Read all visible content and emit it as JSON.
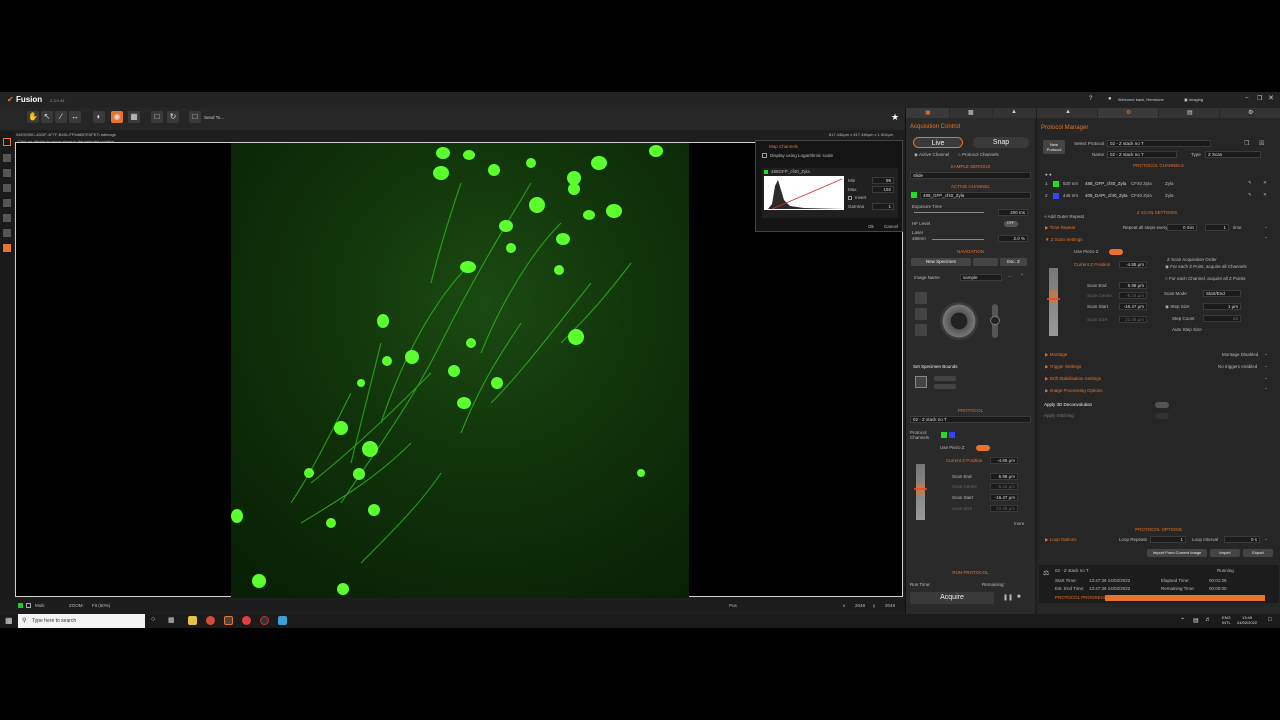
{
  "app": {
    "name": "Fusion",
    "version": "2.3.0.44",
    "welcome": "Welcome back, Hermione",
    "mode": "Imaging"
  },
  "toolbar": {
    "send_to": "Send To..."
  },
  "viewer": {
    "file_path": "04E9930C-4DDF-4F7F-B451-FF9A6B7E0FE7\\.ndimage",
    "hint": "Click on display to move stage to the selected position",
    "dims": "617.446μm x 617.446μm x 1.504μm"
  },
  "map_channels": {
    "title": "Map Channels",
    "log_label": "Display using Logarithmic scale",
    "channel": "488GFP_cf40_Zyla",
    "min_label": "Min",
    "min": "99",
    "max_label": "Max",
    "max": "192",
    "invert": "Invert",
    "gamma_label": "Gamma",
    "gamma": "1",
    "ok": "Ok",
    "cancel": "Cancel"
  },
  "statusbar": {
    "multi": "Multi",
    "zoom_label": "ZOOM:",
    "zoom": "Fit (60%)",
    "pos": "Pos",
    "x_label": "x",
    "x": "2048",
    "y_label": "y",
    "y": "2048"
  },
  "acq": {
    "title": "Acquisition Control",
    "live": "Live",
    "snap": "Snap",
    "active_channel": "Active Channel",
    "protocol_channels": "Protocol Channels",
    "sample_section": "SAMPLE SERIOUS",
    "slide": "Slide",
    "active_channels": "ACTIVE CHANNEL",
    "channel": "488_GFP_cf40_Zyla",
    "exposure_label": "Exposure Time",
    "exposure": "200 ms",
    "hf_label": "HF Level",
    "hf": "OFF",
    "laser_label": "Laser",
    "laser_sub": "488nm",
    "laser": "2.0 %",
    "navigation": "NAVIGATION",
    "new_specimen": "New Specimen",
    "esc_z": "Esc. Z",
    "image_name_label": "Image Name",
    "image_name": "sample",
    "bounds": "Set Specimen Bounds",
    "protocol": "PROTOCOL",
    "protocol_select": "02 - Z stack no T",
    "protocol_channels_label": "Protocol Channels",
    "use_piezo": "Use Piezo Z",
    "current_z_label": "Current Z Position",
    "current_z": "-4.85 μm",
    "scan_end_label": "Scan End",
    "scan_end": "5.98 μm",
    "scan_centre_label": "Scan Centre",
    "scan_centre": "-5.24 μm",
    "scan_start_label": "Scan Start",
    "scan_start": "-16.47 μm",
    "scan_size_label": "Scan Size",
    "scan_size": "22.45 μm",
    "more": "more",
    "run_protocol": "RUN PROTOCOL",
    "run_time": "Run Time:",
    "remaining": "Remaining:",
    "acquire": "Acquire"
  },
  "prot": {
    "title": "Protocol Manager",
    "new_protocol": "New Protocol",
    "select_label": "Select Protocol",
    "select": "02 - Z stack no T",
    "name_label": "Name",
    "name": "02 - Z stack no T",
    "type_label": "Type",
    "type": "Z Scan",
    "channels_title": "PROTOCOL CHANNELS",
    "channels": [
      {
        "num": "1",
        "wl": "520 nm",
        "name": "488_GFP_cf40_Zyla",
        "obj": "CF40 Zyla",
        "cam": "Zyla",
        "color": "#22dd22"
      },
      {
        "num": "2",
        "wl": "445 nm",
        "name": "405_DAPI_cf40_Zyla",
        "obj": "CF40 Zyla",
        "cam": "Zyla",
        "color": "#3344ff"
      }
    ],
    "add_outer": "Add Outer Repeat",
    "zscan_title": "Z SCAN SETTINGS",
    "time_repeat": "Time Repeat",
    "repeat_all": "Repeat all steps every",
    "repeat_val": "0 min",
    "repeat_count": "1",
    "repeat_unit": "time",
    "zscan_settings": "Z Scan Settings",
    "use_piezo": "Use Piezo Z",
    "current_z_label": "Current Z Position",
    "current_z": "-4.85 μm",
    "scan_end_label": "Scan End",
    "scan_end": "5.98 μm",
    "scan_centre_label": "Scan Centre",
    "scan_centre": "-5.24 μm",
    "scan_start_label": "Scan Start",
    "scan_start": "-16.47 μm",
    "scan_size_label": "Scan Size",
    "scan_size": "22.45 μm",
    "order_label": "Z Scan Acquisition Order",
    "order_a": "For each Z Point, acquire all Channels",
    "order_b": "For each Channel, acquire all Z Points",
    "scan_mode_label": "Scan Mode",
    "scan_mode": "Start/End",
    "step_size_label": "Step Size",
    "step_size": "1 μm",
    "step_count_label": "Step Count",
    "step_count": "23",
    "auto_step": "Auto Step Size",
    "montage": "Montage",
    "montage_status": "Montage Disabled",
    "trigger": "Trigger Settings",
    "trigger_status": "No triggers enabled",
    "drift": "Drift Stabilisation Settings",
    "imgproc": "Image Processing Options",
    "decon": "Apply 3D Deconvolution",
    "stitch": "Apply Stitching",
    "options_title": "PROTOCOL OPTIONS",
    "loop_options": "Loop Options",
    "loop_repeats_label": "Loop Repeats",
    "loop_repeats": "1",
    "loop_interval_label": "Loop Interval",
    "loop_interval": "0 s",
    "import_current": "Import From Current Image",
    "import": "Import",
    "export": "Export",
    "run_name": "02 - Z stack no T",
    "run_status": "Running",
    "start_label": "Start Time:",
    "start": "13:47:39 24/02/2022",
    "elapsed_label": "Elapsed Time:",
    "elapsed": "00:01:26",
    "end_label": "Est. End Time:",
    "end": "13:47:39 24/02/2022",
    "remaining_label": "Remaining Time:",
    "remaining": "00:00:00",
    "progress_label": "PROTOCOL PROGRESS",
    "progress": 1.0
  },
  "taskbar": {
    "search": "Type here to search",
    "lang": "ENG",
    "lang2": "INTL",
    "time": "13:49",
    "date": "24/02/2022"
  }
}
